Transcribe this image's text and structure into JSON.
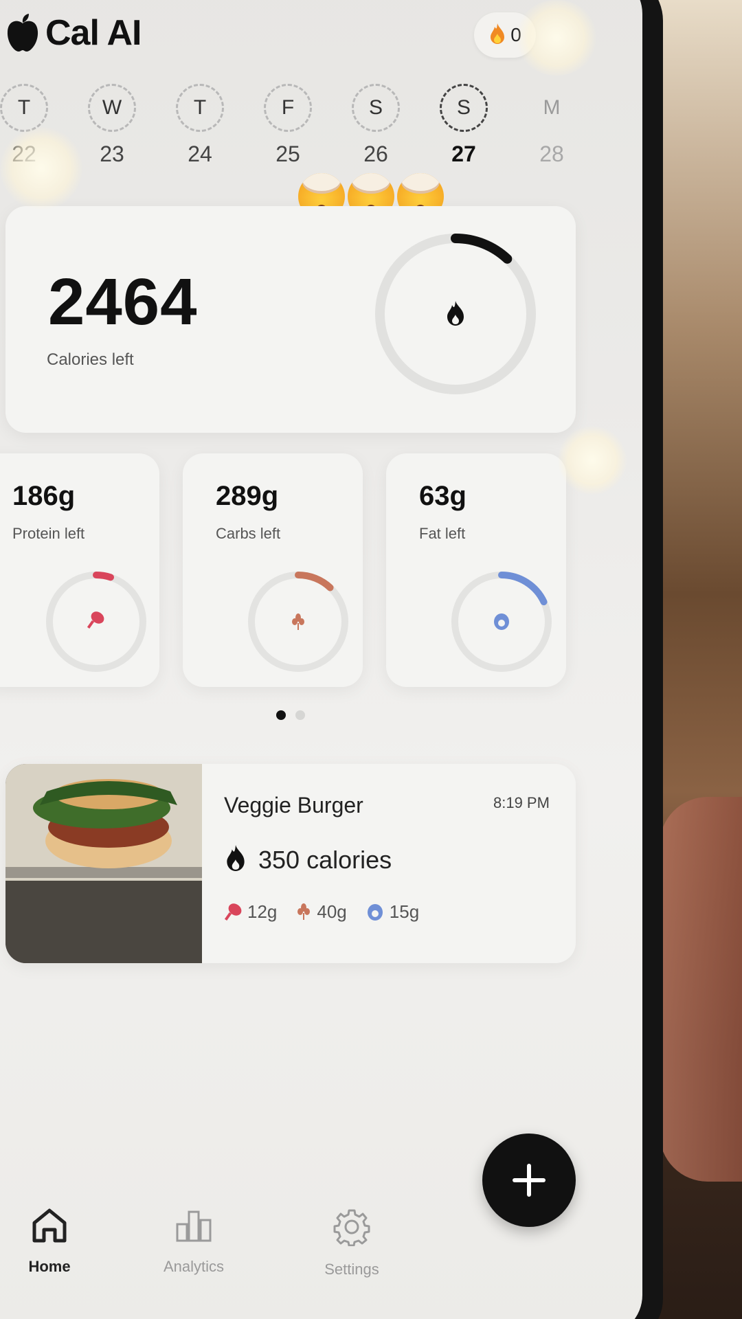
{
  "app": {
    "title": "Cal AI",
    "streak": "0"
  },
  "week": [
    {
      "letter": "T",
      "num": "22"
    },
    {
      "letter": "W",
      "num": "23"
    },
    {
      "letter": "T",
      "num": "24"
    },
    {
      "letter": "F",
      "num": "25"
    },
    {
      "letter": "S",
      "num": "26"
    },
    {
      "letter": "S",
      "num": "27"
    },
    {
      "letter": "M",
      "num": "28"
    }
  ],
  "calories": {
    "value": "2464",
    "label": "Calories left",
    "progress": 0.12
  },
  "macros": [
    {
      "value": "186g",
      "label": "Protein left",
      "color": "#d9455b",
      "progress": 0.05
    },
    {
      "value": "289g",
      "label": "Carbs left",
      "color": "#c8765c",
      "progress": 0.12
    },
    {
      "value": "63g",
      "label": "Fat left",
      "color": "#6f8fd6",
      "progress": 0.18
    }
  ],
  "meal": {
    "name": "Veggie Burger",
    "time": "8:19 PM",
    "calories": "350 calories",
    "protein": "12g",
    "carbs": "40g",
    "fat": "15g"
  },
  "nav": {
    "home": "Home",
    "analytics": "Analytics",
    "settings": "Settings"
  }
}
